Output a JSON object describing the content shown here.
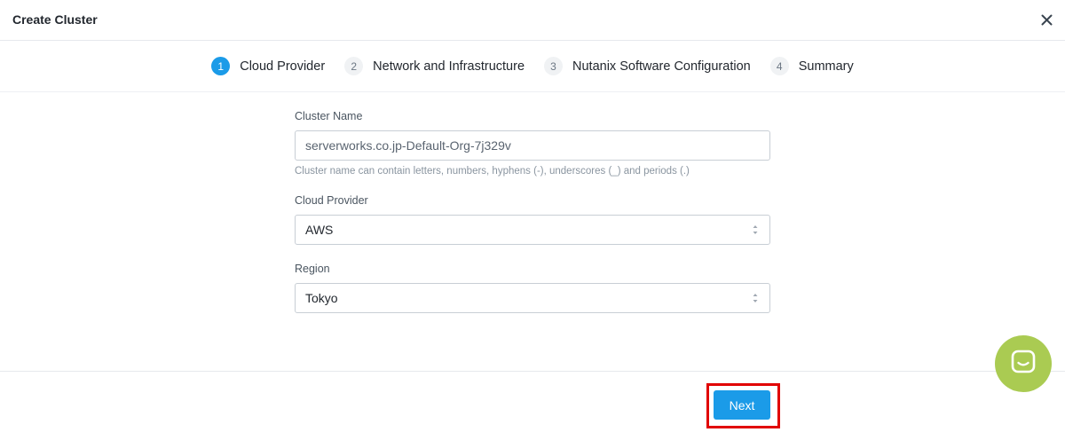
{
  "header": {
    "title": "Create Cluster"
  },
  "steps": [
    {
      "num": "1",
      "label": "Cloud Provider"
    },
    {
      "num": "2",
      "label": "Network and Infrastructure"
    },
    {
      "num": "3",
      "label": "Nutanix Software Configuration"
    },
    {
      "num": "4",
      "label": "Summary"
    }
  ],
  "form": {
    "cluster_name": {
      "label": "Cluster Name",
      "value": "serverworks.co.jp-Default-Org-7j329v",
      "hint": "Cluster name can contain letters, numbers, hyphens (-), underscores (_) and periods (.)"
    },
    "cloud_provider": {
      "label": "Cloud Provider",
      "value": "AWS"
    },
    "region": {
      "label": "Region",
      "value": "Tokyo"
    }
  },
  "footer": {
    "next_label": "Next"
  },
  "colors": {
    "accent": "#1b9be8",
    "highlight": "#e10000",
    "chat": "#aacb52"
  }
}
